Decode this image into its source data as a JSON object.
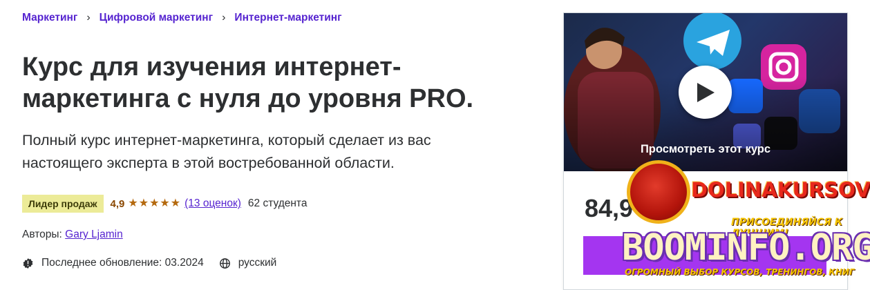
{
  "breadcrumb": [
    {
      "label": "Маркетинг"
    },
    {
      "label": "Цифровой маркетинг"
    },
    {
      "label": "Интернет-маркетинг"
    }
  ],
  "course": {
    "title": "Курс для изучения интернет-маркетинга с нуля до уровня PRO.",
    "subtitle": "Полный курс интернет-маркетинга, который сделает из вас настоящего эксперта в этой востребованной области.",
    "badge": "Лидер продаж",
    "rating": "4,9",
    "stars": 5,
    "ratings_count": "(13 оценок)",
    "students": "62 студента",
    "authors_label": "Авторы:",
    "author": "Gary Ljamin",
    "updated": "Последнее обновление: 03.2024",
    "language": "русский"
  },
  "preview": {
    "label": "Просмотреть этот курс"
  },
  "pricing": {
    "price": "84,9"
  },
  "watermark": {
    "dolina": "DOLINAKURSOV",
    "join": "ПРИСОЕДИНЯЙСЯ К ЛУЧШИМ!",
    "site": "BOOMINFO.ORG",
    "tagline": "ОГРОМНЫЙ ВЫБОР КУРСОВ, ТРЕНИНГОВ, КНИГ"
  },
  "colors": {
    "accent": "#5624d0",
    "badge_bg": "#eceb98",
    "star": "#b4690e",
    "cta": "#a435f0"
  },
  "icons": {
    "breadcrumb_separator": "chevron-right-icon",
    "updated": "alert-badge-icon",
    "language": "globe-icon",
    "play": "play-icon"
  }
}
